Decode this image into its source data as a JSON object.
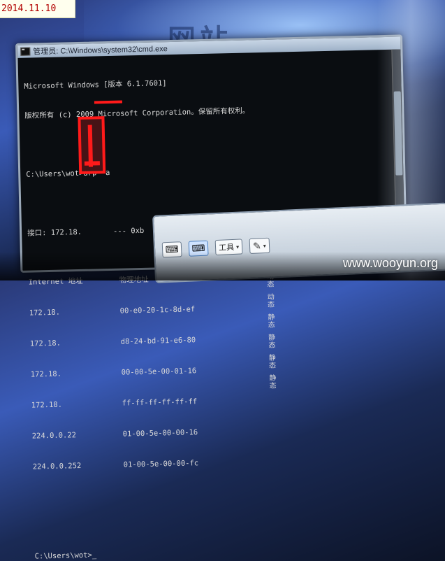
{
  "date_stamp": "2014.11.10",
  "background_text": "网站",
  "cmd": {
    "title": "管理员: C:\\Windows\\system32\\cmd.exe",
    "header_line1": "Microsoft Windows [版本 6.1.7601]",
    "header_line2": "版权所有 (c) 2009 Microsoft Corporation。保留所有权利。",
    "prompt_command": "C:\\Users\\wot>arp -a",
    "interface_line": "接口: 172.18.",
    "interface_suffix": "--- 0xb",
    "col_internet": "Internet 地址",
    "col_physical": "物理地址",
    "rows": [
      {
        "ip": "172.18.",
        "mac": "00-e0-20-1c-8d-ef"
      },
      {
        "ip": "172.18.",
        "mac": "d8-24-bd-91-e6-80"
      },
      {
        "ip": "172.18.",
        "mac": "00-00-5e-00-01-16"
      },
      {
        "ip": "172.18.",
        "mac": "ff-ff-ff-ff-ff-ff"
      },
      {
        "ip": "224.0.0.22",
        "mac": "01-00-5e-00-00-16"
      },
      {
        "ip": "224.0.0.252",
        "mac": "01-00-5e-00-00-fc"
      }
    ],
    "type_column": "类型 动态 动态 静态 静态 静态 静态",
    "final_prompt": "C:\\Users\\wot>_"
  },
  "input_panel": {
    "keyboard_icon": "keyboard-icon",
    "tools_label": "工具",
    "chevron": "▾",
    "pen_icon": "pen-icon"
  },
  "watermark": "www.wooyun.org",
  "colors": {
    "redaction": "#ff1a1a",
    "console_bg": "#0a0d11",
    "console_text": "#d8d8d8"
  }
}
